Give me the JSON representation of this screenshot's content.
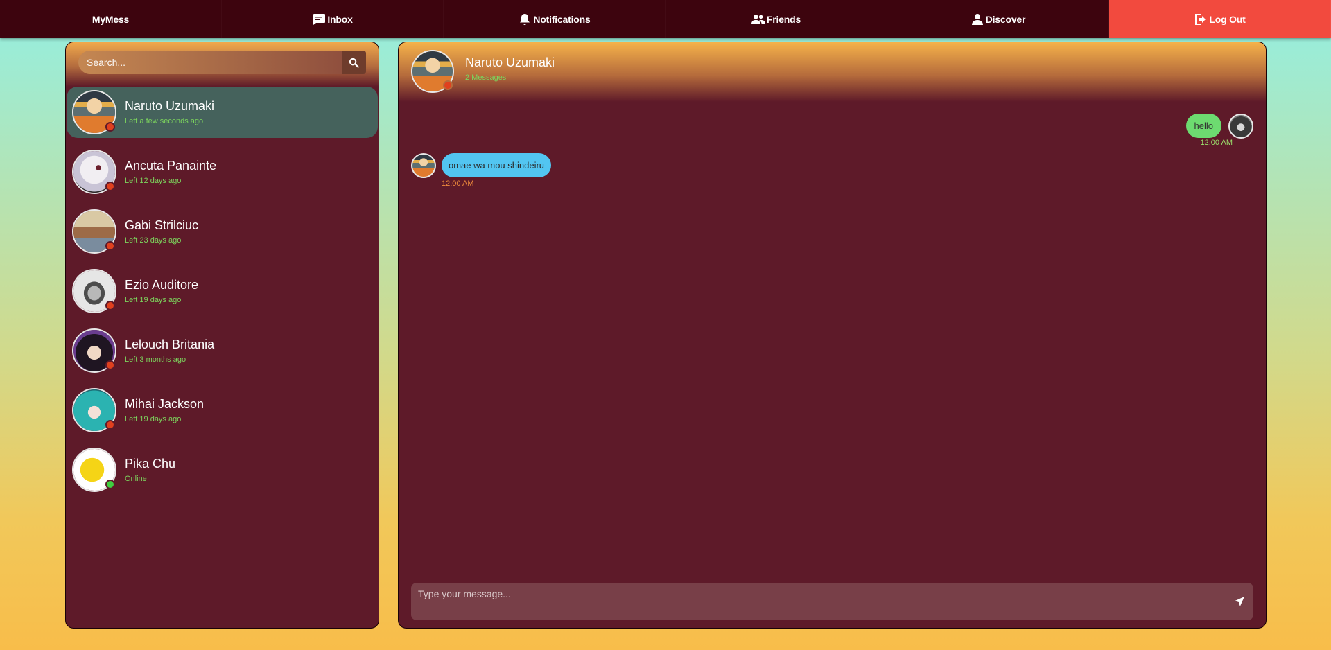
{
  "nav": {
    "brand": "MyMess",
    "inbox": "Inbox",
    "notifications": "Notifications",
    "friends": "Friends",
    "discover": "Discover",
    "logout": "Log Out"
  },
  "search": {
    "placeholder": "Search..."
  },
  "contacts": [
    {
      "name": "Naruto Uzumaki",
      "status": "Left a few seconds ago",
      "online": false
    },
    {
      "name": "Ancuta Panainte",
      "status": "Left 12 days ago",
      "online": false
    },
    {
      "name": "Gabi Strilciuc",
      "status": "Left 23 days ago",
      "online": false
    },
    {
      "name": "Ezio Auditore",
      "status": "Left 19 days ago",
      "online": false
    },
    {
      "name": "Lelouch Britania",
      "status": "Left 3 months ago",
      "online": false
    },
    {
      "name": "Mihai Jackson",
      "status": "Left 19 days ago",
      "online": false
    },
    {
      "name": "Pika Chu",
      "status": "Online",
      "online": true
    }
  ],
  "chat": {
    "title": "Naruto Uzumaki",
    "count": "2 Messages",
    "messages": [
      {
        "direction": "out",
        "text": "hello",
        "time": "12:00 AM"
      },
      {
        "direction": "in",
        "text": "omae wa mou shindeiru",
        "time": "12:00 AM"
      }
    ],
    "composer_placeholder": "Type your message..."
  },
  "colors": {
    "nav_bg": "#3d040e",
    "logout_bg": "#f24a3e",
    "panel_bg": "#5e1a29",
    "active_contact": "#45625c",
    "status_text": "#7cd45d",
    "offline_dot": "#e0401e",
    "online_dot": "#3fcf3f",
    "bubble_out": "#6ddb70",
    "bubble_in": "#52c5f1"
  }
}
